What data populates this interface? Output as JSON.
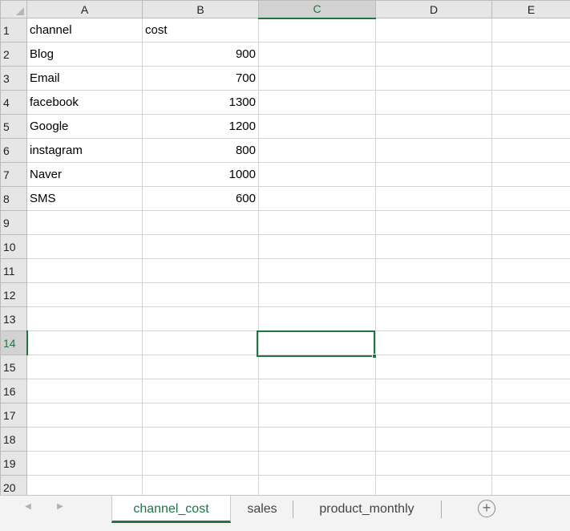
{
  "columns": [
    "A",
    "B",
    "C",
    "D",
    "E"
  ],
  "selected_column": "C",
  "selected_row": "14",
  "rows": [
    {
      "num": "1",
      "a": "channel",
      "b": "cost",
      "b_type": "text"
    },
    {
      "num": "2",
      "a": "Blog",
      "b": "900",
      "b_type": "num"
    },
    {
      "num": "3",
      "a": "Email",
      "b": "700",
      "b_type": "num"
    },
    {
      "num": "4",
      "a": "facebook",
      "b": "1300",
      "b_type": "num"
    },
    {
      "num": "5",
      "a": "Google",
      "b": "1200",
      "b_type": "num"
    },
    {
      "num": "6",
      "a": "instagram",
      "b": "800",
      "b_type": "num"
    },
    {
      "num": "7",
      "a": "Naver",
      "b": "1000",
      "b_type": "num"
    },
    {
      "num": "8",
      "a": "SMS",
      "b": "600",
      "b_type": "num"
    },
    {
      "num": "9",
      "a": "",
      "b": "",
      "b_type": "text"
    },
    {
      "num": "10",
      "a": "",
      "b": "",
      "b_type": "text"
    },
    {
      "num": "11",
      "a": "",
      "b": "",
      "b_type": "text"
    },
    {
      "num": "12",
      "a": "",
      "b": "",
      "b_type": "text"
    },
    {
      "num": "13",
      "a": "",
      "b": "",
      "b_type": "text"
    },
    {
      "num": "14",
      "a": "",
      "b": "",
      "b_type": "text"
    },
    {
      "num": "15",
      "a": "",
      "b": "",
      "b_type": "text"
    },
    {
      "num": "16",
      "a": "",
      "b": "",
      "b_type": "text"
    },
    {
      "num": "17",
      "a": "",
      "b": "",
      "b_type": "text"
    },
    {
      "num": "18",
      "a": "",
      "b": "",
      "b_type": "text"
    },
    {
      "num": "19",
      "a": "",
      "b": "",
      "b_type": "text"
    },
    {
      "num": "20",
      "a": "",
      "b": "",
      "b_type": "text"
    }
  ],
  "tabs": [
    {
      "label": "channel_cost",
      "active": true
    },
    {
      "label": "sales",
      "active": false
    },
    {
      "label": "product_monthly",
      "active": false
    }
  ],
  "nav": {
    "prev_glyph": "◀",
    "next_glyph": "▶",
    "add_glyph": "+"
  },
  "accent_color": "#217346"
}
